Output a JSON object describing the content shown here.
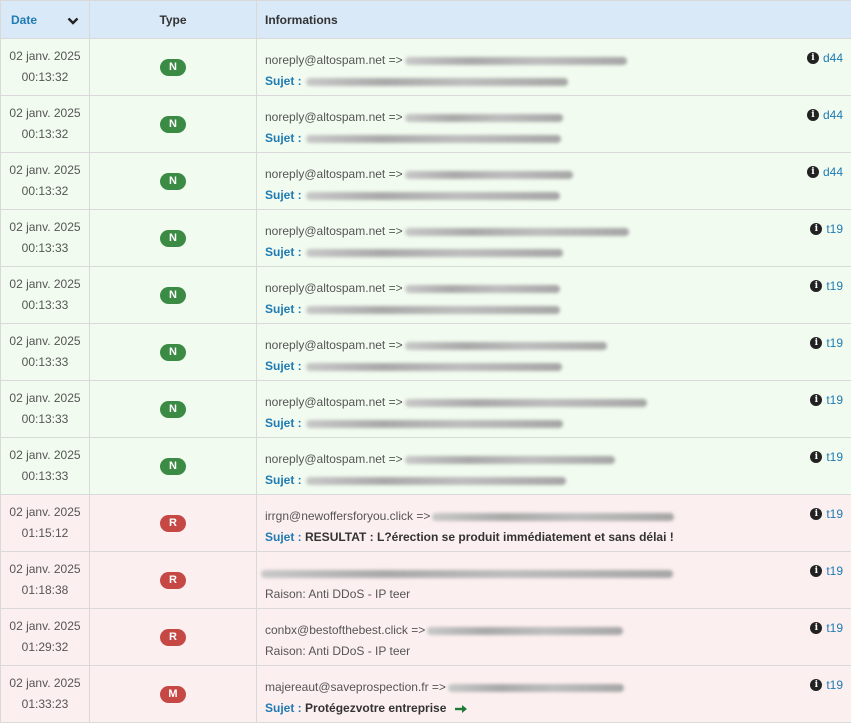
{
  "header": {
    "date": "Date",
    "type": "Type",
    "info": "Informations"
  },
  "rows": [
    {
      "kind": "N",
      "date": "02 janv. 2025",
      "time": "00:13:32",
      "badge": "N",
      "sender": "noreply@altospam.net =>",
      "subject_label": "Sujet :",
      "tag": "d44",
      "redact1": 222,
      "redact2": 262
    },
    {
      "kind": "N",
      "date": "02 janv. 2025",
      "time": "00:13:32",
      "badge": "N",
      "sender": "noreply@altospam.net =>",
      "subject_label": "Sujet :",
      "tag": "d44",
      "redact1": 158,
      "redact2": 255
    },
    {
      "kind": "N",
      "date": "02 janv. 2025",
      "time": "00:13:32",
      "badge": "N",
      "sender": "noreply@altospam.net =>",
      "subject_label": "Sujet :",
      "tag": "d44",
      "redact1": 168,
      "redact2": 254
    },
    {
      "kind": "N",
      "date": "02 janv. 2025",
      "time": "00:13:33",
      "badge": "N",
      "sender": "noreply@altospam.net =>",
      "subject_label": "Sujet :",
      "tag": "t19",
      "redact1": 224,
      "redact2": 257
    },
    {
      "kind": "N",
      "date": "02 janv. 2025",
      "time": "00:13:33",
      "badge": "N",
      "sender": "noreply@altospam.net =>",
      "subject_label": "Sujet :",
      "tag": "t19",
      "redact1": 155,
      "redact2": 254
    },
    {
      "kind": "N",
      "date": "02 janv. 2025",
      "time": "00:13:33",
      "badge": "N",
      "sender": "noreply@altospam.net =>",
      "subject_label": "Sujet :",
      "tag": "t19",
      "redact1": 202,
      "redact2": 256
    },
    {
      "kind": "N",
      "date": "02 janv. 2025",
      "time": "00:13:33",
      "badge": "N",
      "sender": "noreply@altospam.net =>",
      "subject_label": "Sujet :",
      "tag": "t19",
      "redact1": 242,
      "redact2": 257
    },
    {
      "kind": "N",
      "date": "02 janv. 2025",
      "time": "00:13:33",
      "badge": "N",
      "sender": "noreply@altospam.net =>",
      "subject_label": "Sujet :",
      "tag": "t19",
      "redact1": 210,
      "redact2": 260
    },
    {
      "kind": "R",
      "date": "02 janv. 2025",
      "time": "01:15:12",
      "badge": "R",
      "sender": "irrgn@newoffersforyou.click =>",
      "subject_label": "Sujet :",
      "subject": "RESULTAT : L?érection se produit immédiatement et sans délai !",
      "tag": "t19",
      "redact1": 242
    },
    {
      "kind": "R",
      "date": "02 janv. 2025",
      "time": "01:18:38",
      "badge": "R",
      "sender": "",
      "reason": "Raison: Anti DDoS - IP teer",
      "tag": "t19",
      "redact1": 412
    },
    {
      "kind": "R",
      "date": "02 janv. 2025",
      "time": "01:29:32",
      "badge": "R",
      "sender": "conbx@bestofthebest.click =>",
      "reason": "Raison: Anti DDoS - IP teer",
      "tag": "t19",
      "redact1": 196
    },
    {
      "kind": "R",
      "date": "02 janv. 2025",
      "time": "01:33:23",
      "badge": "M",
      "sender": "majereaut@saveprospection.fr =>",
      "subject_label": "Sujet :",
      "subject": "Protégezvotre entreprise",
      "tag": "t19",
      "redact1": 176,
      "arrow": true
    }
  ],
  "colors": {
    "badge_n": "#3b8b45",
    "badge_r": "#c64845",
    "row_n": "#f1fbef",
    "row_r": "#fcefef",
    "link": "#1f7bb3"
  }
}
